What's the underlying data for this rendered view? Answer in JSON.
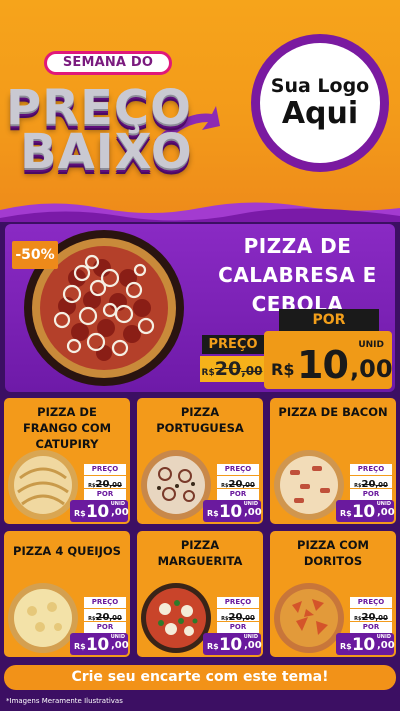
{
  "header": {
    "campaign_top": "SEMANA DO",
    "campaign_line1": "PREÇO",
    "campaign_line2": "BAIXO",
    "logo_line1": "Sua Logo",
    "logo_line2": "Aqui"
  },
  "colors": {
    "orange": "#f39a1a",
    "purple": "#6a1a9e",
    "deep_purple": "#3c0f63",
    "pink": "#e0187a"
  },
  "featured": {
    "discount_badge": "-50%",
    "title_line1": "PIZZA DE",
    "title_line2": "CALABRESA E",
    "title_line3": "CEBOLA",
    "por_label": "POR",
    "preco_label": "PREÇO",
    "old_currency": "R$",
    "old_value": "20",
    "old_cents": ",00",
    "unit": "UNID",
    "currency": "R$",
    "price": "10",
    "cents": ",00",
    "image_icon": "pizza-calabresa-icon"
  },
  "products": [
    {
      "name": "PIZZA DE FRANGO COM CATUPIRY",
      "preco_label": "PREÇO",
      "old_currency": "R$",
      "old_value": "20",
      "old_cents": ",00",
      "por_label": "POR",
      "currency": "R$",
      "price": "10",
      "cents": ",00",
      "unit": "UNID",
      "icon": "pizza-frango-icon"
    },
    {
      "name": "PIZZA PORTUGUESA",
      "preco_label": "PREÇO",
      "old_currency": "R$",
      "old_value": "20",
      "old_cents": ",00",
      "por_label": "POR",
      "currency": "R$",
      "price": "10",
      "cents": ",00",
      "unit": "UNID",
      "icon": "pizza-portuguesa-icon"
    },
    {
      "name": "PIZZA DE BACON",
      "preco_label": "PREÇO",
      "old_currency": "R$",
      "old_value": "20",
      "old_cents": ",00",
      "por_label": "POR",
      "currency": "R$",
      "price": "10",
      "cents": ",00",
      "unit": "UNID",
      "icon": "pizza-bacon-icon"
    },
    {
      "name": "PIZZA 4 QUEIJOS",
      "preco_label": "PREÇO",
      "old_currency": "R$",
      "old_value": "20",
      "old_cents": ",00",
      "por_label": "POR",
      "currency": "R$",
      "price": "10",
      "cents": ",00",
      "unit": "UNID",
      "icon": "pizza-queijos-icon"
    },
    {
      "name": "PIZZA MARGUERITA",
      "preco_label": "PREÇO",
      "old_currency": "R$",
      "old_value": "20",
      "old_cents": ",00",
      "por_label": "POR",
      "currency": "R$",
      "price": "10",
      "cents": ",00",
      "unit": "UNID",
      "icon": "pizza-marguerita-icon"
    },
    {
      "name": "PIZZA COM DORITOS",
      "preco_label": "PREÇO",
      "old_currency": "R$",
      "old_value": "20",
      "old_cents": ",00",
      "por_label": "POR",
      "currency": "R$",
      "price": "10",
      "cents": ",00",
      "unit": "UNID",
      "icon": "pizza-doritos-icon"
    }
  ],
  "cta": "Crie seu encarte com este tema!",
  "footnote": "*Imagens Meramente Ilustrativas"
}
